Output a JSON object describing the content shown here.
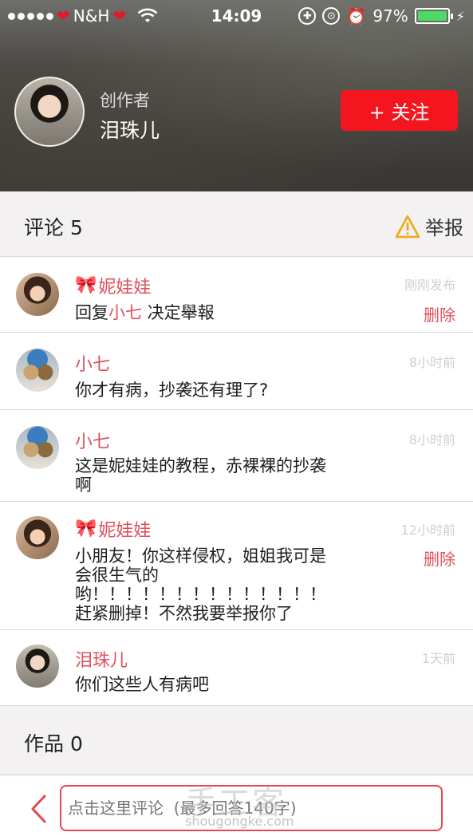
{
  "status_bar": {
    "carrier": "N&H",
    "time": "14:09",
    "battery": "97%"
  },
  "author": {
    "role": "创作者",
    "name": "泪珠儿",
    "follow_label": "+ 关注"
  },
  "comments_section": {
    "title": "评论 5",
    "report_label": "举报"
  },
  "comments": [
    {
      "name": "妮娃娃",
      "time": "刚刚发布",
      "delete": "删除",
      "reply_prefix": "回复",
      "mention": "小七",
      "reply_suffix": " 决定舉報"
    },
    {
      "name": "小七",
      "time": "8小时前",
      "text": "你才有病，抄袭还有理了?"
    },
    {
      "name": "小七",
      "time": "8小时前",
      "text1": "这是妮娃娃的教程，赤裸裸的抄袭",
      "text2": "啊"
    },
    {
      "name": "妮娃娃",
      "time": "12小时前",
      "delete": "删除",
      "text1": "小朋友！你这样侵权，姐姐我可是",
      "text2": "会很生气的",
      "text3": "哟！！！！！！！！！！！！！！",
      "text4": "赶紧删掉！不然我要举报你了"
    },
    {
      "name": "泪珠儿",
      "time": "1天前",
      "text": "你们这些人有病吧"
    }
  ],
  "works_section": {
    "title": "作品 0"
  },
  "input": {
    "placeholder": "点击这里评论  (最多回答140字)"
  },
  "watermark": {
    "main": "手工客",
    "sub": "shougongke.com"
  },
  "colors": {
    "accent": "#f4161e",
    "name_red": "#e0505a",
    "section_bg": "#f3f1f1"
  }
}
